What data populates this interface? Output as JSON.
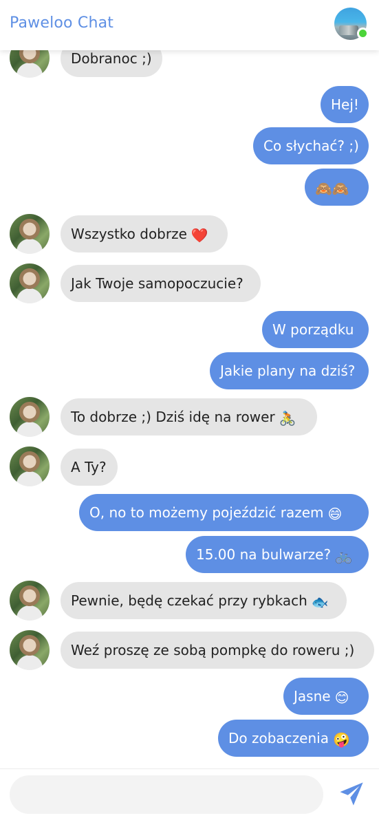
{
  "app": {
    "title": "Paweloo Chat"
  },
  "composer": {
    "placeholder": ""
  },
  "messages": [
    {
      "from": "them",
      "text": "Dobranoc ;)",
      "emoji": ""
    },
    {
      "from": "me",
      "text": "Hej!",
      "emoji": ""
    },
    {
      "from": "me",
      "text": "Co słychać? ;)",
      "emoji": ""
    },
    {
      "from": "me",
      "text": "",
      "emoji": "🙈🙈"
    },
    {
      "from": "them",
      "text": "Wszystko dobrze",
      "emoji": "❤️"
    },
    {
      "from": "them",
      "text": "Jak Twoje samopoczucie?",
      "emoji": ""
    },
    {
      "from": "me",
      "text": "W porządku",
      "emoji": ""
    },
    {
      "from": "me",
      "text": "Jakie plany na dziś?",
      "emoji": ""
    },
    {
      "from": "them",
      "text": "To dobrze ;) Dziś idę na rower",
      "emoji": "🚴"
    },
    {
      "from": "them",
      "text": "A Ty?",
      "emoji": ""
    },
    {
      "from": "me",
      "text": "O, no to możemy pojeździć razem",
      "emoji": "😄"
    },
    {
      "from": "me",
      "text": "15.00 na bulwarze?",
      "emoji": "🚲"
    },
    {
      "from": "them",
      "text": "Pewnie, będę czekać przy rybkach",
      "emoji": "🐟"
    },
    {
      "from": "them",
      "text": "Weź proszę ze sobą pompkę do roweru ;)",
      "emoji": ""
    },
    {
      "from": "me",
      "text": "Jasne",
      "emoji": "😊"
    },
    {
      "from": "me",
      "text": "Do zobaczenia",
      "emoji": "🤪"
    }
  ]
}
